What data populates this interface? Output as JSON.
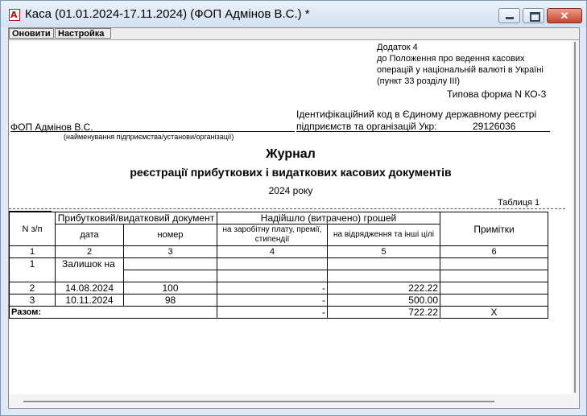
{
  "window": {
    "title": "Каса (01.01.2024-17.11.2024) (ФОП Адмінов В.С.)  *",
    "close_glyph": "✕"
  },
  "menu": [
    "Оновити",
    "Настройка"
  ],
  "doc": {
    "appendix": [
      "Додаток 4",
      "до Положення про ведення касових",
      "операцій у національній валюті в Україні",
      "(пункт 33 розділу ІІІ)"
    ],
    "form": "Типова форма N КО-3",
    "code_label_1": "Ідентифікаційний код в Єдиному державному реєстрі",
    "code_label_2": "підприємств та організацій Укр:",
    "code_value": "29126036",
    "company": "ФОП Адмінов В.С.",
    "company_caption": "(найменування підприємства/установи/організації)",
    "title": "Журнал",
    "subtitle": "реєстрації прибуткових і видаткових касових документів",
    "year": "2024 року",
    "table_label": "Таблиця 1"
  },
  "table": {
    "h_num": "N з/п",
    "h_doc": "Прибутковий/видатковий документ",
    "h_received": "Надійшло (витрачено) грошей",
    "h_notes": "Примітки",
    "h_date": "дата",
    "h_number": "номер",
    "h_salary": "на заробітну плату, премії, стипендії",
    "h_travel": "на відрядження та інші цілі",
    "col_nums": [
      "1",
      "2",
      "3",
      "4",
      "5",
      "6"
    ],
    "balance_num": "1",
    "balance_label": "Залишок на",
    "rows": [
      {
        "n": "2",
        "date": "14.08.2024",
        "number": "100",
        "salary": "-",
        "travel": "222.22",
        "note": ""
      },
      {
        "n": "3",
        "date": "10.11.2024",
        "number": "98",
        "salary": "-",
        "travel": "500.00",
        "note": ""
      }
    ],
    "total_label": "Разом:",
    "total_salary": "-",
    "total_travel": "722.22",
    "total_note": "X"
  }
}
